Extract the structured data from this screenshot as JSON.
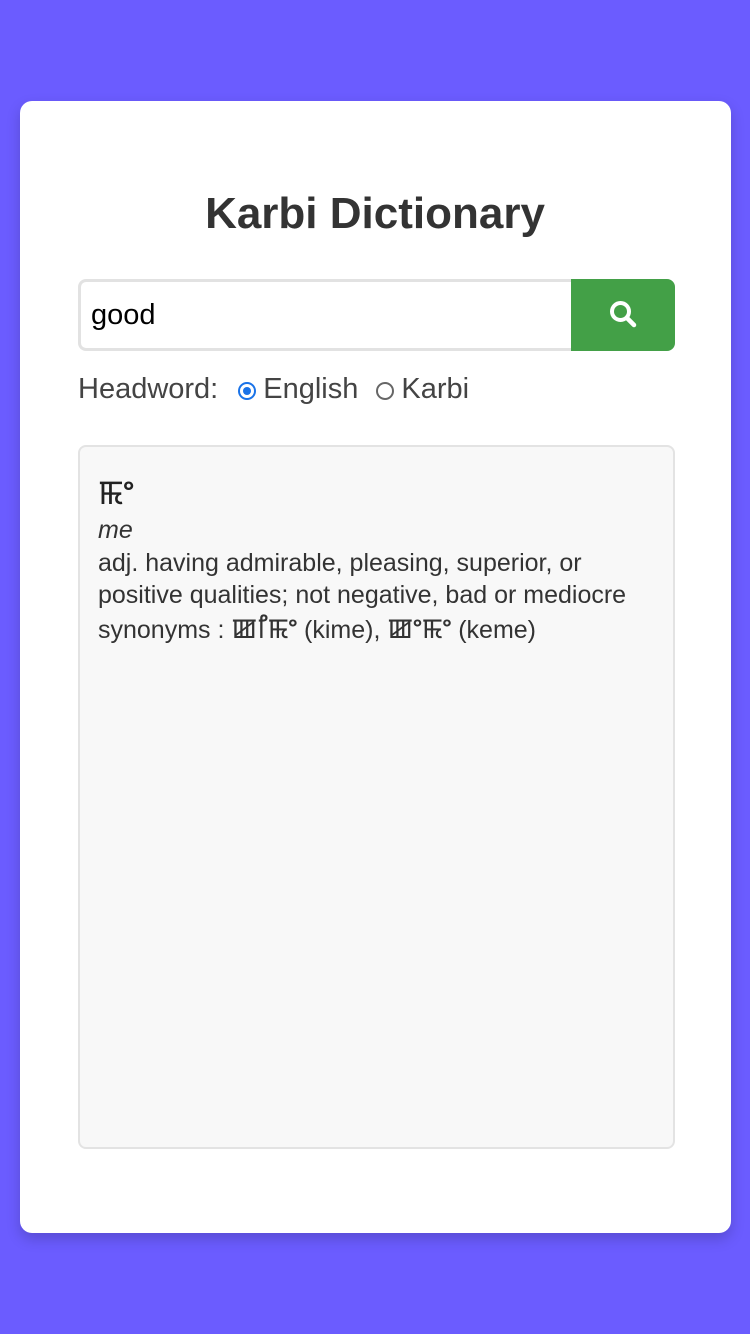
{
  "app": {
    "title": "Karbi Dictionary"
  },
  "search": {
    "value": "good",
    "placeholder": "",
    "button_icon": "search-icon"
  },
  "headword": {
    "label": "Headword:",
    "options": [
      {
        "label": "English",
        "checked": true
      },
      {
        "label": "Karbi",
        "checked": false
      }
    ]
  },
  "result": {
    "word": "ꯃꯦ",
    "romanization": "me",
    "definition": "adj. having admirable, pleasing, superior, or positive qualities; not negative, bad or mediocre",
    "synonyms_label": "synonyms :",
    "synonyms": [
      {
        "script": "ꯀꯤꯃꯦ",
        "roman": "(kime)",
        "separator": ","
      },
      {
        "script": "ꯀꯦꯃꯦ",
        "roman": "(keme)",
        "separator": ""
      }
    ]
  },
  "colors": {
    "background": "#6b5cff",
    "card": "#ffffff",
    "search_button": "#43a047",
    "radio_selected": "#1a73e8"
  }
}
